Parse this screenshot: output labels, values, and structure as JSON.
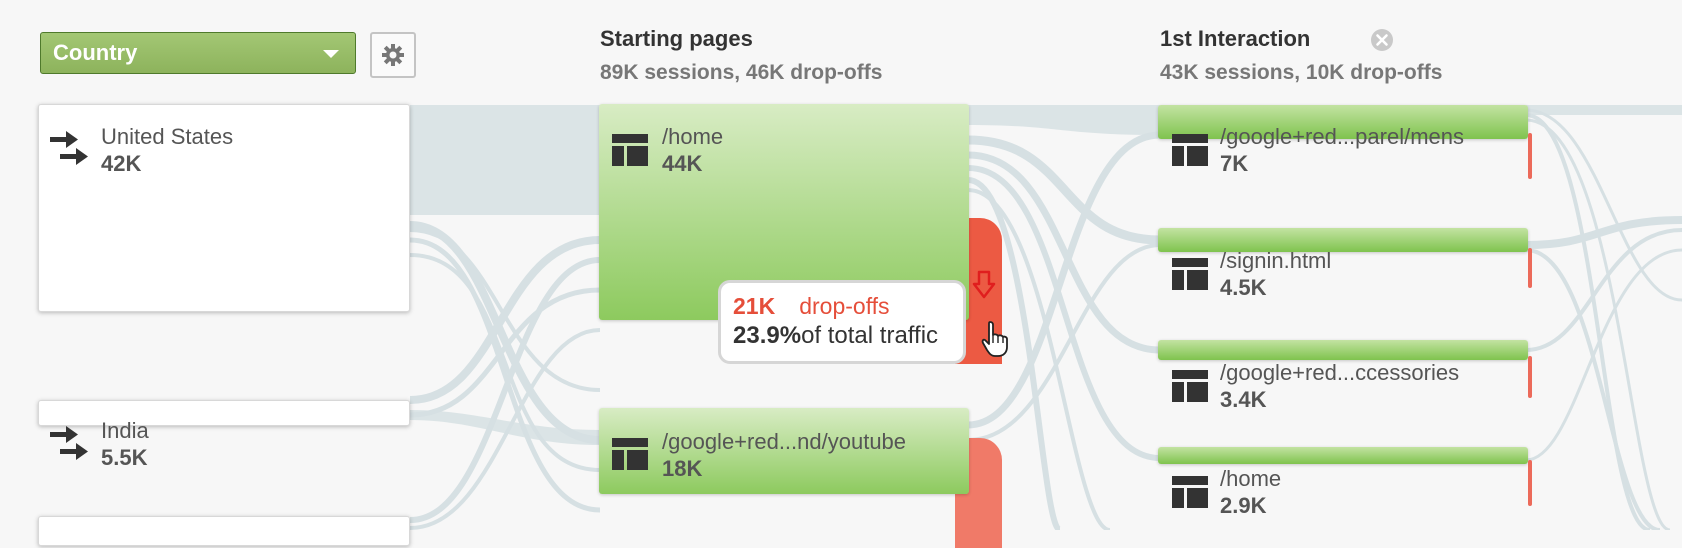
{
  "dimension": {
    "selected": "Country"
  },
  "columns": [
    {
      "title": "Starting pages",
      "subtitle": "89K sessions, 46K drop-offs"
    },
    {
      "title": "1st Interaction",
      "subtitle": "43K sessions, 10K drop-offs"
    }
  ],
  "countries": [
    {
      "name": "United States",
      "value": "42K"
    },
    {
      "name": "India",
      "value": "5.5K"
    }
  ],
  "starting_pages": [
    {
      "path": "/home",
      "value": "44K"
    },
    {
      "path": "/google+red...nd/youtube",
      "value": "18K"
    }
  ],
  "first_interaction": [
    {
      "path": "/google+red...parel/mens",
      "value": "7K"
    },
    {
      "path": "/signin.html",
      "value": "4.5K"
    },
    {
      "path": "/google+red...ccessories",
      "value": "3.4K"
    },
    {
      "path": "/home",
      "value": "2.9K"
    }
  ],
  "tooltip": {
    "count": "21K",
    "label": "drop-offs",
    "percent": "23.9%",
    "percent_label": "of total traffic"
  },
  "colors": {
    "node_green": "#8dca5e",
    "dropoff_red": "#ec5a43",
    "flow_gray": "#d6e0e3",
    "background": "#f7f7f7"
  },
  "icons": {
    "page": "page-layout-icon",
    "country": "double-arrow-icon",
    "settings": "gear-icon",
    "remove_step": "close-circle-icon",
    "drop_off": "arrow-down-icon",
    "pointer": "hand-cursor-icon"
  }
}
